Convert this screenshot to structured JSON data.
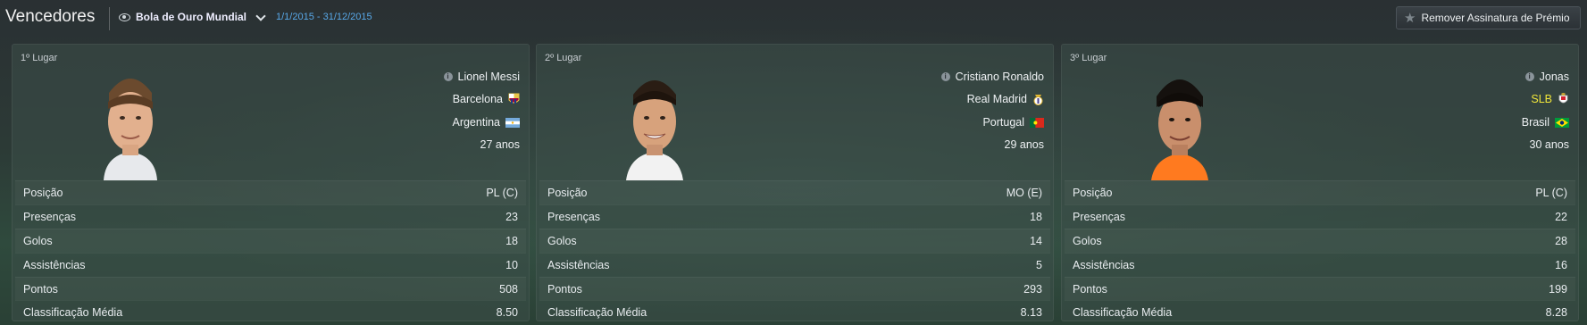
{
  "header": {
    "title": "Vencedores",
    "award": "Bola de Ouro Mundial",
    "period": "1/1/2015 - 31/12/2015",
    "remove_button": "Remover Assinatura de Prémio"
  },
  "stat_labels": [
    "Posição",
    "Presenças",
    "Golos",
    "Assistências",
    "Pontos",
    "Classificação Média"
  ],
  "winners": [
    {
      "place": "1º Lugar",
      "name": "Lionel Messi",
      "club": "Barcelona",
      "nation": "Argentina",
      "age": "27 anos",
      "stats": [
        "PL (C)",
        "23",
        "18",
        "10",
        "508",
        "8.50"
      ]
    },
    {
      "place": "2º Lugar",
      "name": "Cristiano Ronaldo",
      "club": "Real Madrid",
      "nation": "Portugal",
      "age": "29 anos",
      "stats": [
        "MO (E)",
        "18",
        "14",
        "5",
        "293",
        "8.13"
      ]
    },
    {
      "place": "3º Lugar",
      "name": "Jonas",
      "club": "SLB",
      "nation": "Brasil",
      "age": "30 anos",
      "stats": [
        "PL (C)",
        "22",
        "28",
        "16",
        "199",
        "8.28"
      ]
    }
  ],
  "colors": {
    "accent_link": "#58a8e8",
    "highlight_club": "#f0e63a"
  }
}
